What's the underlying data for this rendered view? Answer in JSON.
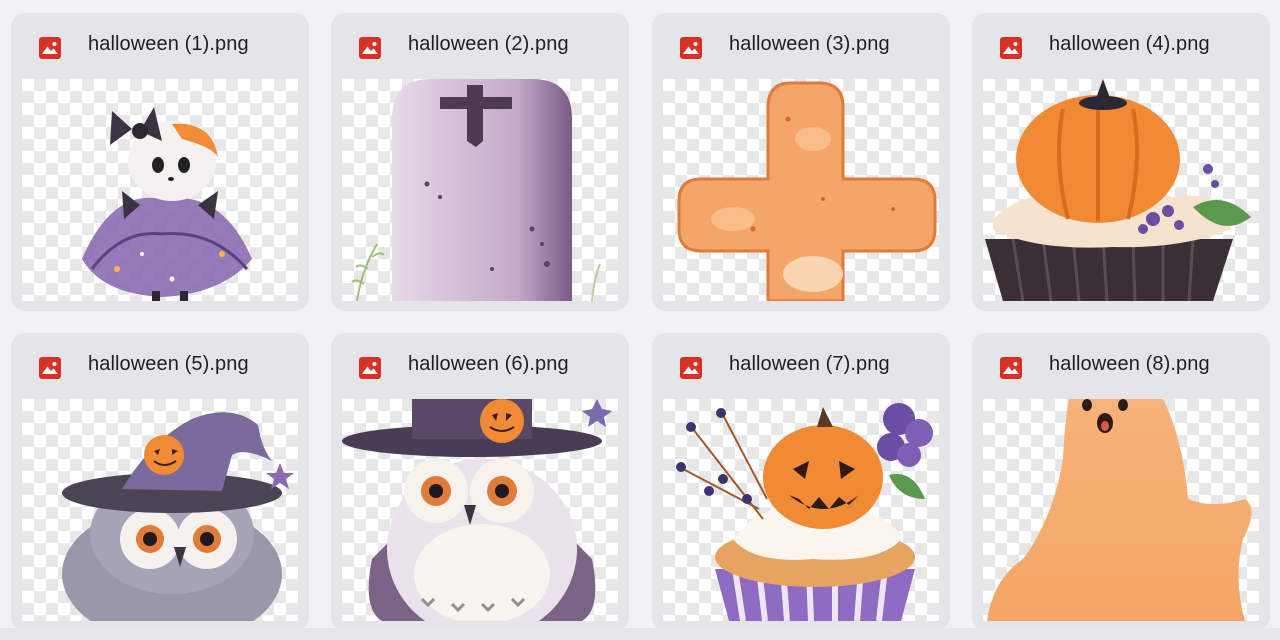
{
  "files": [
    {
      "name": "halloween (1).png",
      "icon": "image-file-icon",
      "thumb": "ghost-girl-in-tutu"
    },
    {
      "name": "halloween (2).png",
      "icon": "image-file-icon",
      "thumb": "tombstone"
    },
    {
      "name": "halloween (3).png",
      "icon": "image-file-icon",
      "thumb": "orange-cross"
    },
    {
      "name": "halloween (4).png",
      "icon": "image-file-icon",
      "thumb": "pumpkin-cupcake"
    },
    {
      "name": "halloween (5).png",
      "icon": "image-file-icon",
      "thumb": "owl-with-witch-hat"
    },
    {
      "name": "halloween (6).png",
      "icon": "image-file-icon",
      "thumb": "white-owl-with-hat"
    },
    {
      "name": "halloween (7).png",
      "icon": "image-file-icon",
      "thumb": "jack-o-lantern-cupcake"
    },
    {
      "name": "halloween (8).png",
      "icon": "image-file-icon",
      "thumb": "orange-ghost"
    }
  ],
  "colors": {
    "icon_red": "#d93025",
    "card_bg": "#e3e5e9",
    "page_bg": "#f1f2f4"
  }
}
